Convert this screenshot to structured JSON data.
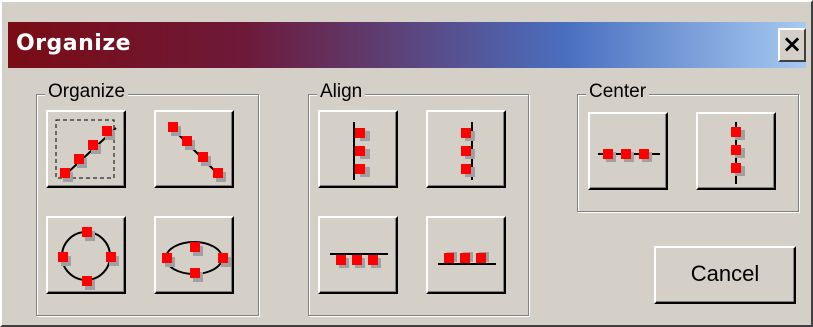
{
  "window": {
    "title": "Organize",
    "close_label": "×"
  },
  "groups": {
    "organize": {
      "label": "Organize"
    },
    "align": {
      "label": "Align"
    },
    "center": {
      "label": "Center"
    }
  },
  "buttons": {
    "cancel": "Cancel"
  },
  "colors": {
    "accent_red": "#ff0000",
    "shadow_gray": "#a0a0a0"
  }
}
